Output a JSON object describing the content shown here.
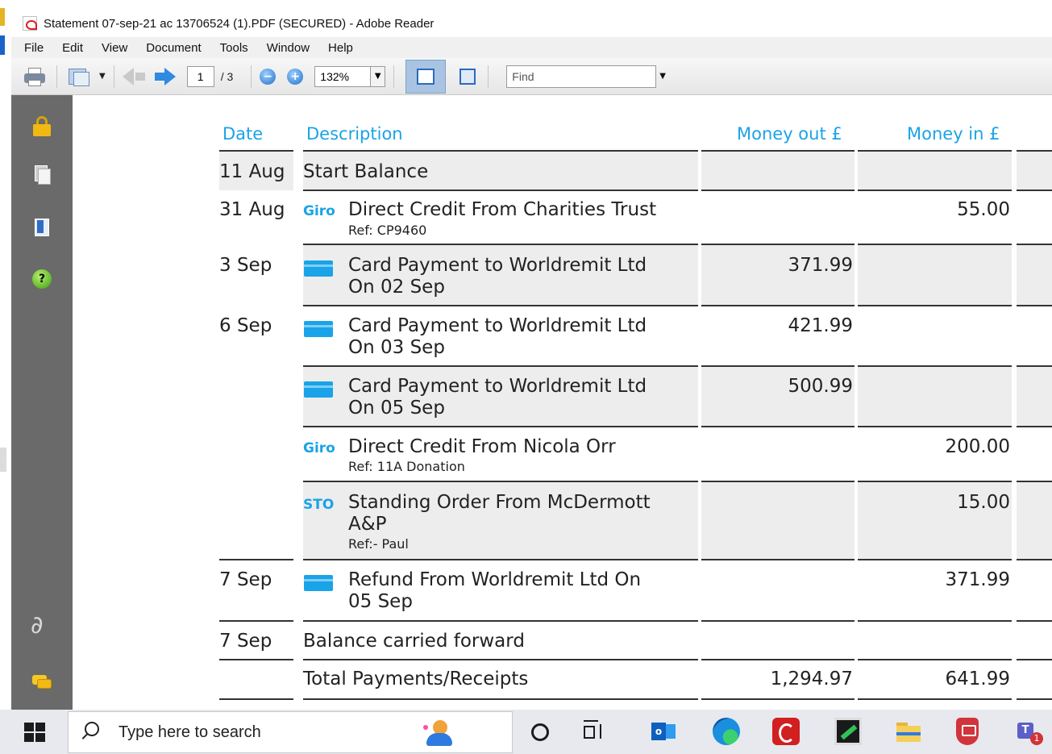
{
  "window": {
    "title": "Statement 07-sep-21 ac 13706524 (1).PDF (SECURED) - Adobe Reader"
  },
  "menu": [
    "File",
    "Edit",
    "View",
    "Document",
    "Tools",
    "Window",
    "Help"
  ],
  "toolbar": {
    "current_page": "1",
    "page_total": "/ 3",
    "zoom": "132%",
    "find_placeholder": "Find"
  },
  "nav_icons": [
    "lock-icon",
    "pages-icon",
    "bookmark-icon",
    "help-icon",
    "attachment-icon",
    "comment-icon"
  ],
  "statement": {
    "headers": {
      "date": "Date",
      "description": "Description",
      "money_out": "Money out £",
      "money_in": "Money in £"
    },
    "rows": [
      {
        "date": "11 Aug",
        "type": "",
        "lines": [
          "Start Balance"
        ],
        "ref": "",
        "out": "",
        "in": ""
      },
      {
        "date": "31 Aug",
        "type": "Giro",
        "lines": [
          "Direct Credit From Charities Trust"
        ],
        "ref": "Ref: CP9460",
        "out": "",
        "in": "55.00"
      },
      {
        "date": "3 Sep",
        "type": "card",
        "lines": [
          "Card Payment to Worldremit Ltd",
          "On 02 Sep"
        ],
        "ref": "",
        "out": "371.99",
        "in": ""
      },
      {
        "date": "6 Sep",
        "type": "card",
        "lines": [
          "Card Payment to Worldremit Ltd",
          "On 03 Sep"
        ],
        "ref": "",
        "out": "421.99",
        "in": ""
      },
      {
        "date": "",
        "type": "card",
        "lines": [
          "Card Payment to Worldremit Ltd",
          "On 05 Sep"
        ],
        "ref": "",
        "out": "500.99",
        "in": ""
      },
      {
        "date": "",
        "type": "Giro",
        "lines": [
          "Direct Credit From Nicola Orr"
        ],
        "ref": "Ref: 11A Donation",
        "out": "",
        "in": "200.00"
      },
      {
        "date": "",
        "type": "STO",
        "lines": [
          "Standing Order From McDermott",
          "A&P"
        ],
        "ref": "Ref:- Paul",
        "out": "",
        "in": "15.00"
      },
      {
        "date": "7 Sep",
        "type": "card",
        "lines": [
          "Refund From Worldremit Ltd On",
          "05 Sep"
        ],
        "ref": "",
        "out": "",
        "in": "371.99"
      },
      {
        "date": "7 Sep",
        "type": "",
        "lines": [
          "Balance carried forward"
        ],
        "ref": "",
        "out": "",
        "in": ""
      }
    ],
    "total": {
      "label": "Total Payments/Receipts",
      "out": "1,294.97",
      "in": "641.99"
    }
  },
  "taskbar": {
    "search_placeholder": "Type here to search",
    "teams_badge": "1",
    "apps": [
      "cortana-icon",
      "task-view-icon",
      "outlook-icon",
      "edge-icon",
      "red-app-icon",
      "green-app-icon",
      "file-explorer-icon",
      "shield-app-icon",
      "teams-icon"
    ]
  },
  "colors": {
    "accent_blue": "#1aa3e8",
    "nav_panel": "#6a6a6a",
    "row_shade": "#ededed"
  }
}
